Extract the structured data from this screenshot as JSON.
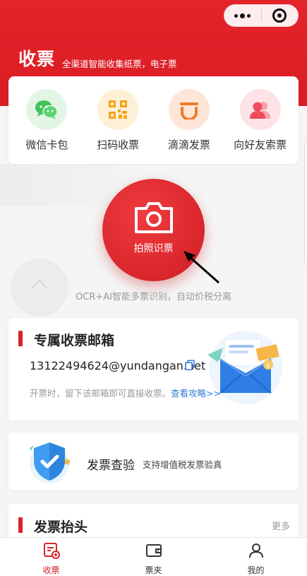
{
  "header": {
    "title": "收票",
    "subtitle": "全渠道智能收集纸票，电子票"
  },
  "capsule": {
    "more_icon": "more-dots-icon",
    "close_icon": "target-icon"
  },
  "entries": [
    {
      "label": "微信卡包",
      "icon": "wechat-icon",
      "color": "#41c45a",
      "bg": "#e3f6e6"
    },
    {
      "label": "扫码收票",
      "icon": "qrcode-icon",
      "color": "#f2a51b",
      "bg": "#fdf0d7"
    },
    {
      "label": "滴滴发票",
      "icon": "didi-icon",
      "color": "#f07b2a",
      "bg": "#fde6d7"
    },
    {
      "label": "向好友索票",
      "icon": "friends-icon",
      "color": "#ef4b5b",
      "bg": "#fde2e6"
    }
  ],
  "photo": {
    "label": "拍照识票",
    "note": "OCR+AI智能多票识别，自动价税分离"
  },
  "mailbox": {
    "title": "专属收票邮箱",
    "email": "13122494624@yundangan.net",
    "hint": "开票时，留下该邮箱即可直接收票。",
    "link": "查看攻略>>"
  },
  "verify": {
    "title": "发票查验",
    "subtitle": "支持增值税发票验真"
  },
  "invoice_header": {
    "title": "发票抬头",
    "more": "更多"
  },
  "tabs": [
    {
      "label": "收票",
      "icon": "receive-ticket-icon",
      "active": true
    },
    {
      "label": "票夹",
      "icon": "wallet-icon",
      "active": false
    },
    {
      "label": "我的",
      "icon": "user-icon",
      "active": false
    }
  ],
  "colors": {
    "brand_red": "#d9232a",
    "link_blue": "#2f7cd8"
  }
}
